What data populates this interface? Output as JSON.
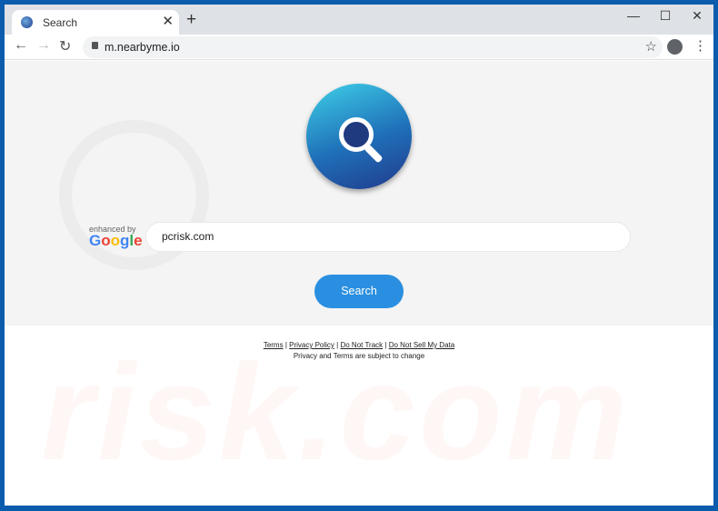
{
  "browser": {
    "tab_title": "Search",
    "url": "m.nearbyme.io",
    "accent": "#2a8fe0",
    "frame_color": "#0b5cad"
  },
  "page": {
    "enhanced_by": "enhanced by",
    "google": [
      "G",
      "o",
      "o",
      "g",
      "l",
      "e"
    ],
    "search_value": "pcrisk.com",
    "search_button": "Search",
    "links": [
      "Terms",
      "Privacy Policy",
      "Do Not Track",
      "Do Not Sell My Data"
    ],
    "separator": "|",
    "note": "Privacy and Terms are subject to change"
  },
  "watermark": "risk.com"
}
